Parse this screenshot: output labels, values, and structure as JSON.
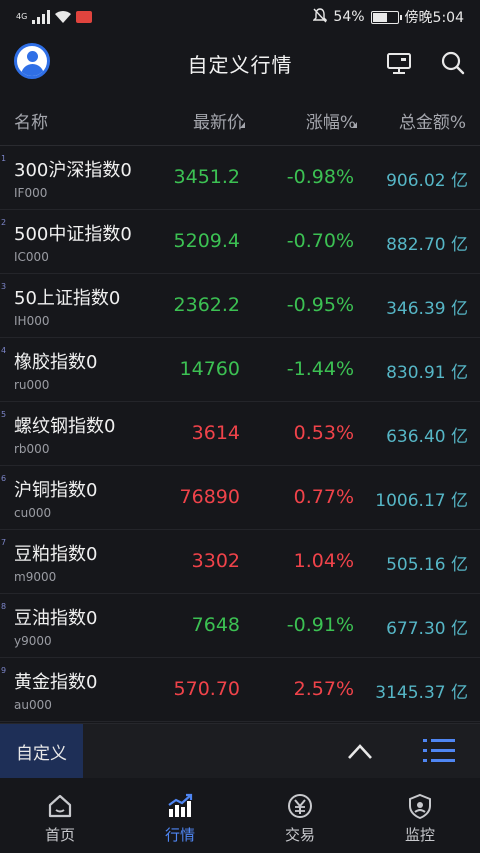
{
  "status": {
    "network": "4G",
    "battery": "54%",
    "time": "傍晚5:04"
  },
  "header": {
    "title": "自定义行情",
    "icons": [
      "avatar",
      "monitor-icon",
      "search-icon"
    ]
  },
  "columns": {
    "name": "名称",
    "price": "最新价",
    "change": "涨幅%",
    "amount": "总金额%"
  },
  "rows": [
    {
      "index": "1",
      "name": "300沪深指数0",
      "code": "IF000",
      "price": "3451.2",
      "change": "-0.98%",
      "amount": "906.02 亿",
      "trend": "down"
    },
    {
      "index": "2",
      "name": "500中证指数0",
      "code": "IC000",
      "price": "5209.4",
      "change": "-0.70%",
      "amount": "882.70 亿",
      "trend": "down"
    },
    {
      "index": "3",
      "name": "50上证指数0",
      "code": "IH000",
      "price": "2362.2",
      "change": "-0.95%",
      "amount": "346.39 亿",
      "trend": "down"
    },
    {
      "index": "4",
      "name": "橡胶指数0",
      "code": "ru000",
      "price": "14760",
      "change": "-1.44%",
      "amount": "830.91 亿",
      "trend": "down"
    },
    {
      "index": "5",
      "name": "螺纹钢指数0",
      "code": "rb000",
      "price": "3614",
      "change": "0.53%",
      "amount": "636.40 亿",
      "trend": "up"
    },
    {
      "index": "6",
      "name": "沪铜指数0",
      "code": "cu000",
      "price": "76890",
      "change": "0.77%",
      "amount": "1006.17 亿",
      "trend": "up"
    },
    {
      "index": "7",
      "name": "豆粕指数0",
      "code": "m9000",
      "price": "3302",
      "change": "1.04%",
      "amount": "505.16 亿",
      "trend": "up"
    },
    {
      "index": "8",
      "name": "豆油指数0",
      "code": "y9000",
      "price": "7648",
      "change": "-0.91%",
      "amount": "677.30 亿",
      "trend": "down"
    },
    {
      "index": "9",
      "name": "黄金指数0",
      "code": "au000",
      "price": "570.70",
      "change": "2.57%",
      "amount": "3145.37 亿",
      "trend": "up"
    }
  ],
  "groupbar": {
    "active_group": "自定义"
  },
  "tabs": [
    {
      "label": "首页",
      "icon": "home-icon"
    },
    {
      "label": "行情",
      "icon": "market-chart-icon"
    },
    {
      "label": "交易",
      "icon": "trade-yuan-icon"
    },
    {
      "label": "监控",
      "icon": "monitor-shield-icon"
    }
  ],
  "colors": {
    "up": "#f0434a",
    "down": "#3cc153",
    "amount": "#56b6c6",
    "accent": "#4f86f3"
  }
}
